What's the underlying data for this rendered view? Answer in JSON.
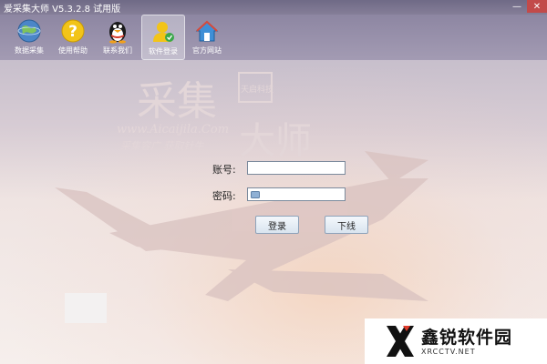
{
  "window": {
    "title": "爱采集大师 V5.3.2.8 试用版",
    "controls": [
      "—",
      "✕"
    ]
  },
  "toolbar": {
    "items": [
      {
        "label": "数据采集",
        "icon": "globe-icon"
      },
      {
        "label": "使用帮助",
        "icon": "help-icon"
      },
      {
        "label": "联系我们",
        "icon": "penguin-icon"
      },
      {
        "label": "软件登录",
        "icon": "user-login-icon",
        "active": true
      },
      {
        "label": "官方网站",
        "icon": "home-icon"
      }
    ]
  },
  "watermark": {
    "logo_chars": "采集",
    "badge": "天启科技",
    "url": "www.Aicaijila.Com",
    "slogan": "采集容广 获取针牛",
    "master_chars": "大师"
  },
  "login": {
    "account_label": "账号:",
    "account_value": "",
    "password_label": "密码:",
    "password_value": "",
    "login_button": "登录",
    "logout_button": "下线"
  },
  "site_watermark": {
    "name": "鑫锐软件园",
    "url": "XRCCTV.NET"
  }
}
